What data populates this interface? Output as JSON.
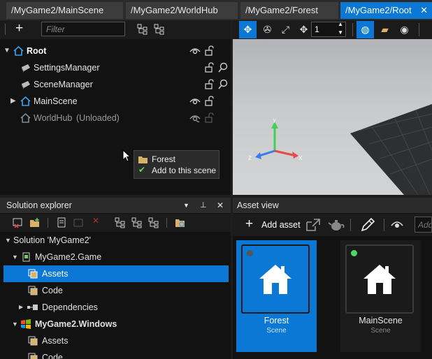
{
  "tabs": [
    {
      "label": "/MyGame2/MainScene",
      "active": false
    },
    {
      "label": "/MyGame2/WorldHub",
      "active": false
    },
    {
      "label": "/MyGame2/Forest",
      "active": false
    },
    {
      "label": "/MyGame2/Root",
      "active": true
    }
  ],
  "scene_tree": {
    "filter_placeholder": "Filter",
    "nodes": [
      {
        "label": "Root"
      },
      {
        "label": "SettingsManager"
      },
      {
        "label": "SceneManager"
      },
      {
        "label": "MainScene"
      },
      {
        "label": "WorldHub",
        "state": "(Unloaded)"
      }
    ]
  },
  "drag_tooltip": {
    "item": "Forest",
    "action": "Add to this scene"
  },
  "viewport": {
    "step_value": "1",
    "axes": {
      "x": "X",
      "y": "Y",
      "z": "Z"
    },
    "colors": {
      "x": "#e84a4a",
      "y": "#3dd15a",
      "z": "#3a7bf0",
      "sky": "#c4c6c8",
      "ground": "#2e2f31"
    }
  },
  "solution_explorer": {
    "title": "Solution explorer",
    "rows": [
      {
        "label": "Solution 'MyGame2'"
      },
      {
        "label": "MyGame2.Game"
      },
      {
        "label": "Assets",
        "selected": true
      },
      {
        "label": "Code"
      },
      {
        "label": "Dependencies"
      },
      {
        "label": "MyGame2.Windows"
      },
      {
        "label": "Assets"
      },
      {
        "label": "Code"
      }
    ]
  },
  "asset_view": {
    "title": "Asset view",
    "add_asset_label": "Add asset",
    "search_placeholder": "Add",
    "assets": [
      {
        "name": "Forest",
        "type": "Scene",
        "selected": true,
        "status_color": "#555555"
      },
      {
        "name": "MainScene",
        "type": "Scene",
        "selected": false,
        "status_color": "#4cd964"
      }
    ]
  },
  "colors": {
    "accent": "#0a78d4",
    "panel": "#121212",
    "toolbar": "#1b1b1b",
    "header": "#2b2b2b"
  }
}
